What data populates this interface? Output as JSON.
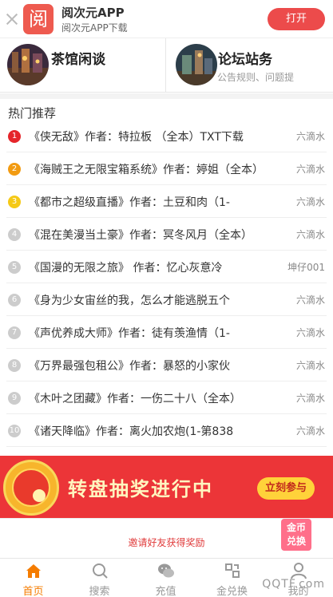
{
  "app_banner": {
    "logo_char": "阅",
    "title": "阅次元APP",
    "subtitle": "阅次元APP下载",
    "open_label": "打开"
  },
  "forums": [
    {
      "name": "茶馆闲谈",
      "desc": ""
    },
    {
      "name": "论坛站务",
      "desc": "公告规则、问题提"
    }
  ],
  "hot": {
    "title": "热门推荐",
    "items": [
      {
        "rank": "1",
        "title": "《侠无敌》作者：特拉板 （全本）TXT下载",
        "author": "六滴水",
        "badge_color": "#e5252a"
      },
      {
        "rank": "2",
        "title": "《海贼王之无限宝箱系统》作者：婷姐（全本）",
        "author": "六滴水",
        "badge_color": "#f29b12"
      },
      {
        "rank": "3",
        "title": "《都市之超级直播》作者：土豆和肉（1-",
        "author": "六滴水",
        "badge_color": "#f5c916"
      },
      {
        "rank": "4",
        "title": "《混在美漫当土豪》作者：冥冬风月（全本）",
        "author": "六滴水",
        "badge_color": "#cccccc"
      },
      {
        "rank": "5",
        "title": "《国漫的无限之旅》 作者：忆心灰意冷",
        "author": "坤仔001",
        "badge_color": "#cccccc"
      },
      {
        "rank": "6",
        "title": "《身为少女宙丝的我，怎么才能逃脱五个",
        "author": "六滴水",
        "badge_color": "#cccccc"
      },
      {
        "rank": "7",
        "title": "《声优养成大师》作者：徒有羡渔情（1-",
        "author": "六滴水",
        "badge_color": "#cccccc"
      },
      {
        "rank": "8",
        "title": "《万界最强包租公》作者：暴怒的小家伙",
        "author": "六滴水",
        "badge_color": "#cccccc"
      },
      {
        "rank": "9",
        "title": "《木叶之团藏》作者：一伤二十八（全本）",
        "author": "六滴水",
        "badge_color": "#cccccc"
      },
      {
        "rank": "10",
        "title": "《诸天降临》作者：离火加农炮(1-第838",
        "author": "六滴水",
        "badge_color": "#cccccc"
      }
    ]
  },
  "lottery": {
    "slogan": "转盘抽奖进行中",
    "join_label": "立刻参与"
  },
  "invite": {
    "text": "邀请好友获得奖励",
    "exchange_label": "金币兑换"
  },
  "tabbar": [
    {
      "label": "首页",
      "icon": "home-icon",
      "active": true
    },
    {
      "label": "搜索",
      "icon": "search-icon",
      "active": false
    },
    {
      "label": "充值",
      "icon": "wechat-icon",
      "active": false
    },
    {
      "label": "金兑换",
      "icon": "exchange-icon",
      "active": false
    },
    {
      "label": "我的",
      "icon": "user-icon",
      "active": false
    }
  ],
  "watermark": "QQTF.com",
  "colors": {
    "accent": "#ec4b4b",
    "tab_active": "#f57c00",
    "lottery_bg": "#ec3538"
  }
}
